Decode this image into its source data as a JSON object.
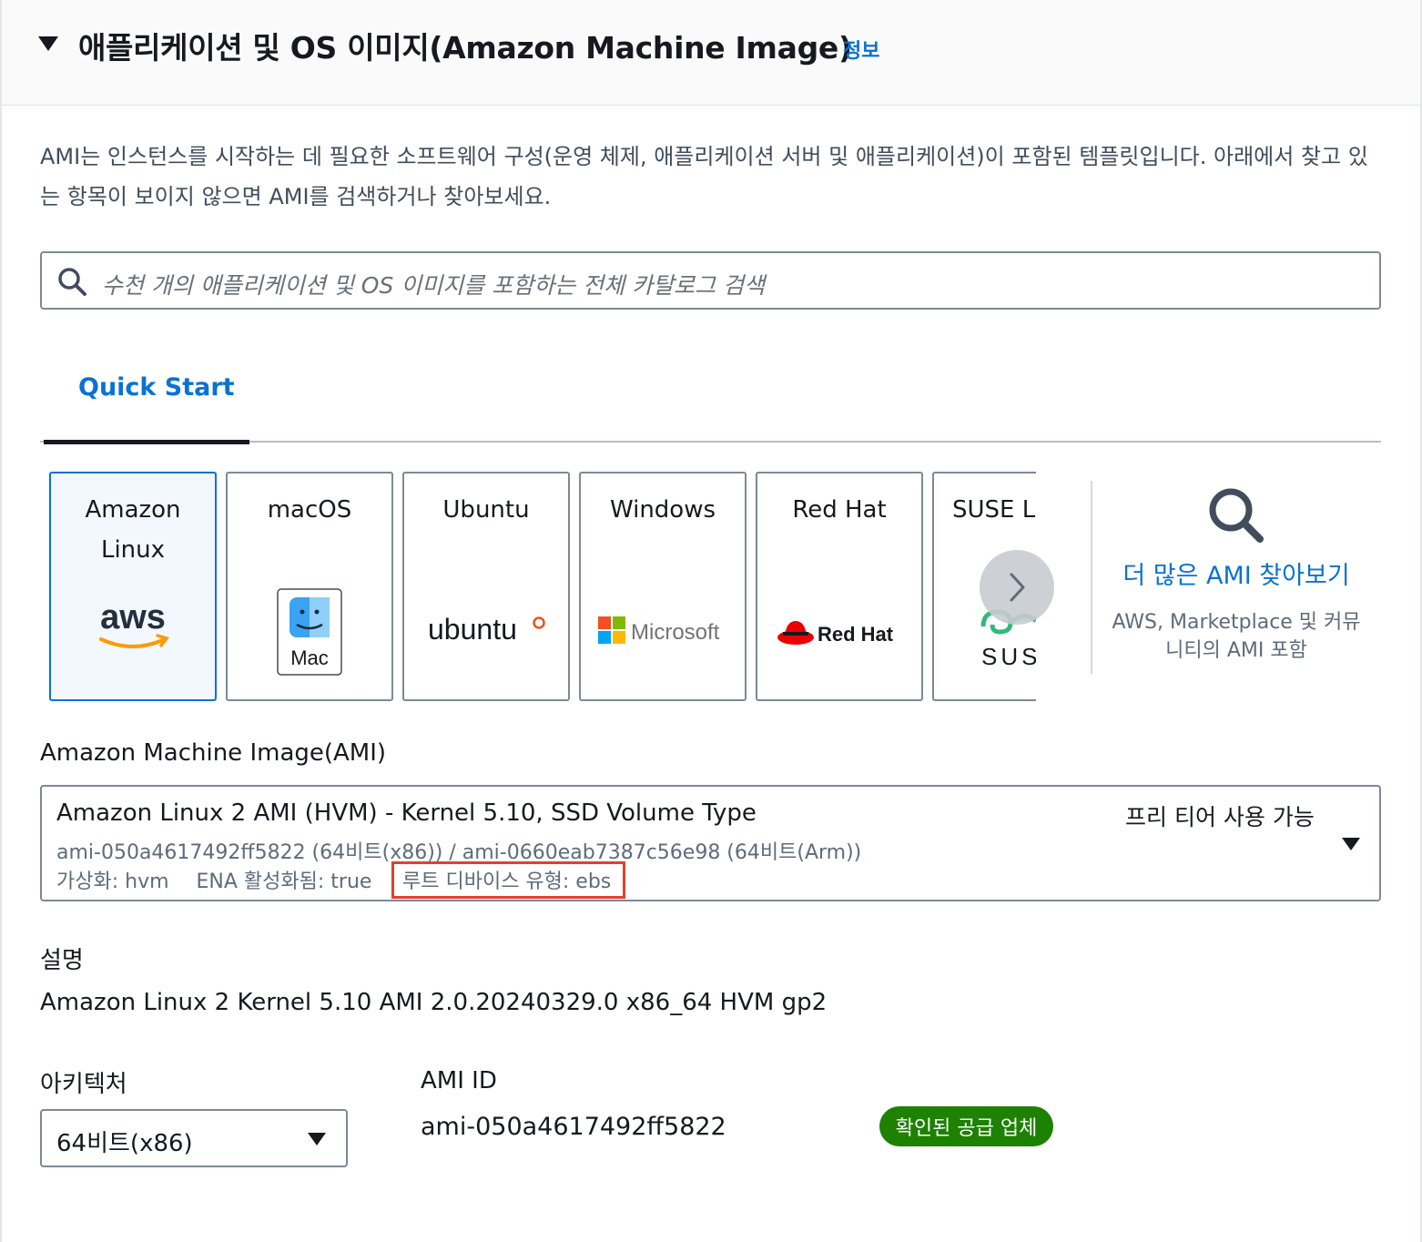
{
  "section": {
    "title": "애플리케이션 및 OS 이미지(Amazon Machine Image)",
    "info_link": "정보",
    "description": "AMI는 인스턴스를 시작하는 데 필요한 소프트웨어 구성(운영 체제, 애플리케이션 서버 및 애플리케이션)이 포함된 템플릿입니다. 아래에서 찾고 있는 항목이 보이지 않으면 AMI를 검색하거나 찾아보세요."
  },
  "search": {
    "placeholder": "수천 개의 애플리케이션 및 OS 이미지를 포함하는 전체 카탈로그 검색"
  },
  "tabs": [
    {
      "label": "Quick Start",
      "active": true
    }
  ],
  "os_tiles": [
    {
      "name": "Amazon Linux",
      "logo_text": "aws",
      "selected": true
    },
    {
      "name": "macOS",
      "logo_text": "Mac",
      "selected": false
    },
    {
      "name": "Ubuntu",
      "logo_text": "ubuntu",
      "selected": false
    },
    {
      "name": "Windows",
      "logo_text": "Microsoft",
      "selected": false
    },
    {
      "name": "Red Hat",
      "logo_text": "Red Hat",
      "selected": false
    },
    {
      "name": "SUSE Li",
      "logo_text": "SUS",
      "selected": false
    }
  ],
  "browse": {
    "link": "더 많은 AMI 찾아보기",
    "description": "AWS, Marketplace 및 커뮤니티의 AMI 포함"
  },
  "ami": {
    "label": "Amazon Machine Image(AMI)",
    "name": "Amazon Linux 2 AMI (HVM) - Kernel 5.10, SSD Volume Type",
    "free_tier": "프리 티어 사용 가능",
    "ids": "ami-050a4617492ff5822 (64비트(x86)) / ami-0660eab7387c56e98 (64비트(Arm))",
    "virtualization": "가상화: hvm",
    "ena": "ENA 활성화됨: true",
    "root_device": "루트 디바이스 유형: ebs"
  },
  "description": {
    "label": "설명",
    "value": "Amazon Linux 2 Kernel 5.10 AMI 2.0.20240329.0 x86_64 HVM gp2"
  },
  "architecture": {
    "label": "아키텍처",
    "value": "64비트(x86)"
  },
  "ami_id": {
    "label": "AMI ID",
    "value": "ami-050a4617492ff5822"
  },
  "badge": {
    "verified": "확인된 공급 업체"
  },
  "colors": {
    "link": "#0972d3",
    "badge": "#1d8102",
    "highlight": "#e0412d",
    "aws_orange": "#ff9900",
    "redhat_red": "#ee0000",
    "suse_green": "#30ba78",
    "ubuntu_orange": "#e95420"
  }
}
